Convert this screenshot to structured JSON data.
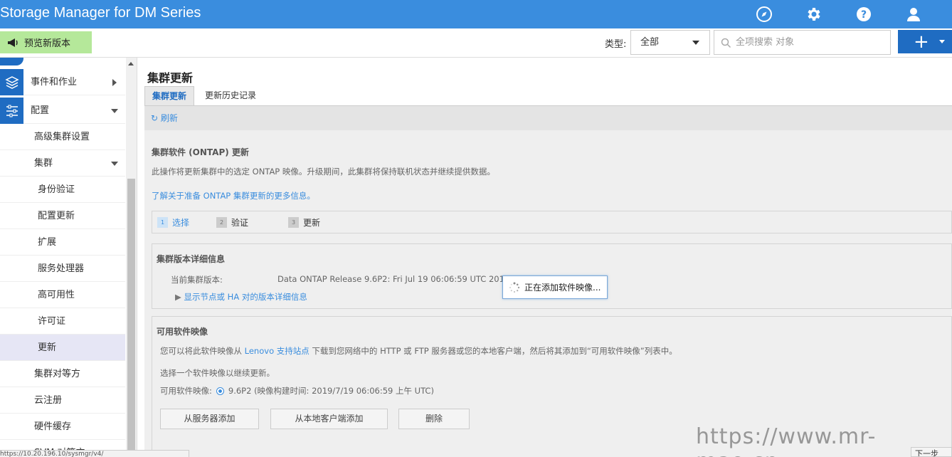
{
  "app": {
    "title": "Storage Manager for DM Series"
  },
  "header_icons": [
    "compass-icon",
    "gear-icon",
    "help-icon",
    "user-icon"
  ],
  "toolbar": {
    "preview_label": "预览新版本",
    "type_label": "类型:",
    "type_value": "全部",
    "search_placeholder": "全项搜索 对象",
    "add_symbol": "+"
  },
  "sidebar": {
    "items": [
      {
        "label": "事件和作业"
      },
      {
        "label": "配置"
      },
      {
        "label": "高级集群设置"
      },
      {
        "label": "集群"
      },
      {
        "label": "身份验证"
      },
      {
        "label": "配置更新"
      },
      {
        "label": "扩展"
      },
      {
        "label": "服务处理器"
      },
      {
        "label": "高可用性"
      },
      {
        "label": "许可证"
      },
      {
        "label": "更新"
      },
      {
        "label": "集群对等方"
      },
      {
        "label": "云注册"
      },
      {
        "label": "硬件缓存"
      },
      {
        "label": "SVM 对等方"
      }
    ]
  },
  "main": {
    "title": "集群更新",
    "tabs": [
      {
        "label": "集群更新"
      },
      {
        "label": "更新历史记录"
      }
    ],
    "refresh_label": "刷新",
    "ontap": {
      "title": "集群软件 (ONTAP) 更新",
      "description": "此操作将更新集群中的选定 ONTAP 映像。升级期间，此集群将保持联机状态并继续提供数据。",
      "learn_more": "了解关于准备 ONTAP 集群更新的更多信息。"
    },
    "steps": [
      {
        "num": "1",
        "label": "选择"
      },
      {
        "num": "2",
        "label": "验证"
      },
      {
        "num": "3",
        "label": "更新"
      }
    ],
    "version_panel": {
      "title": "集群版本详细信息",
      "current_label": "当前集群版本:",
      "current_value": "Data ONTAP Release 9.6P2: Fri Jul 19 06:06:59 UTC 2019 (",
      "toggle_label": "显示节点或 HA 对的版本详细信息"
    },
    "images_panel": {
      "title": "可用软件映像",
      "desc_prefix": "您可以将此软件映像从",
      "desc_link": "Lenovo 支持站点",
      "desc_suffix": "下载到您网络中的 HTTP 或 FTP 服务器或您的本地客户端，然后将其添加到“可用软件映像”列表中。",
      "select_prompt": "选择一个软件映像以继续更新。",
      "available_label": "可用软件映像:",
      "image_option": "9.6P2 (映像构建时间: 2019/7/19 06:06:59 上午 UTC)",
      "buttons": {
        "add_server": "从服务器添加",
        "add_local": "从本地客户端添加",
        "delete": "删除"
      }
    },
    "loading_text": "正在添加软件映像..."
  },
  "footer": {
    "status_url": "https://10.20.196.10/sysmgr/v4/",
    "next_label": "下一步"
  },
  "watermark": "https://www.mr-mao.cn",
  "colors": {
    "header": "#3a8dde",
    "accent": "#1f6cc2",
    "preview": "#b5e89a"
  }
}
